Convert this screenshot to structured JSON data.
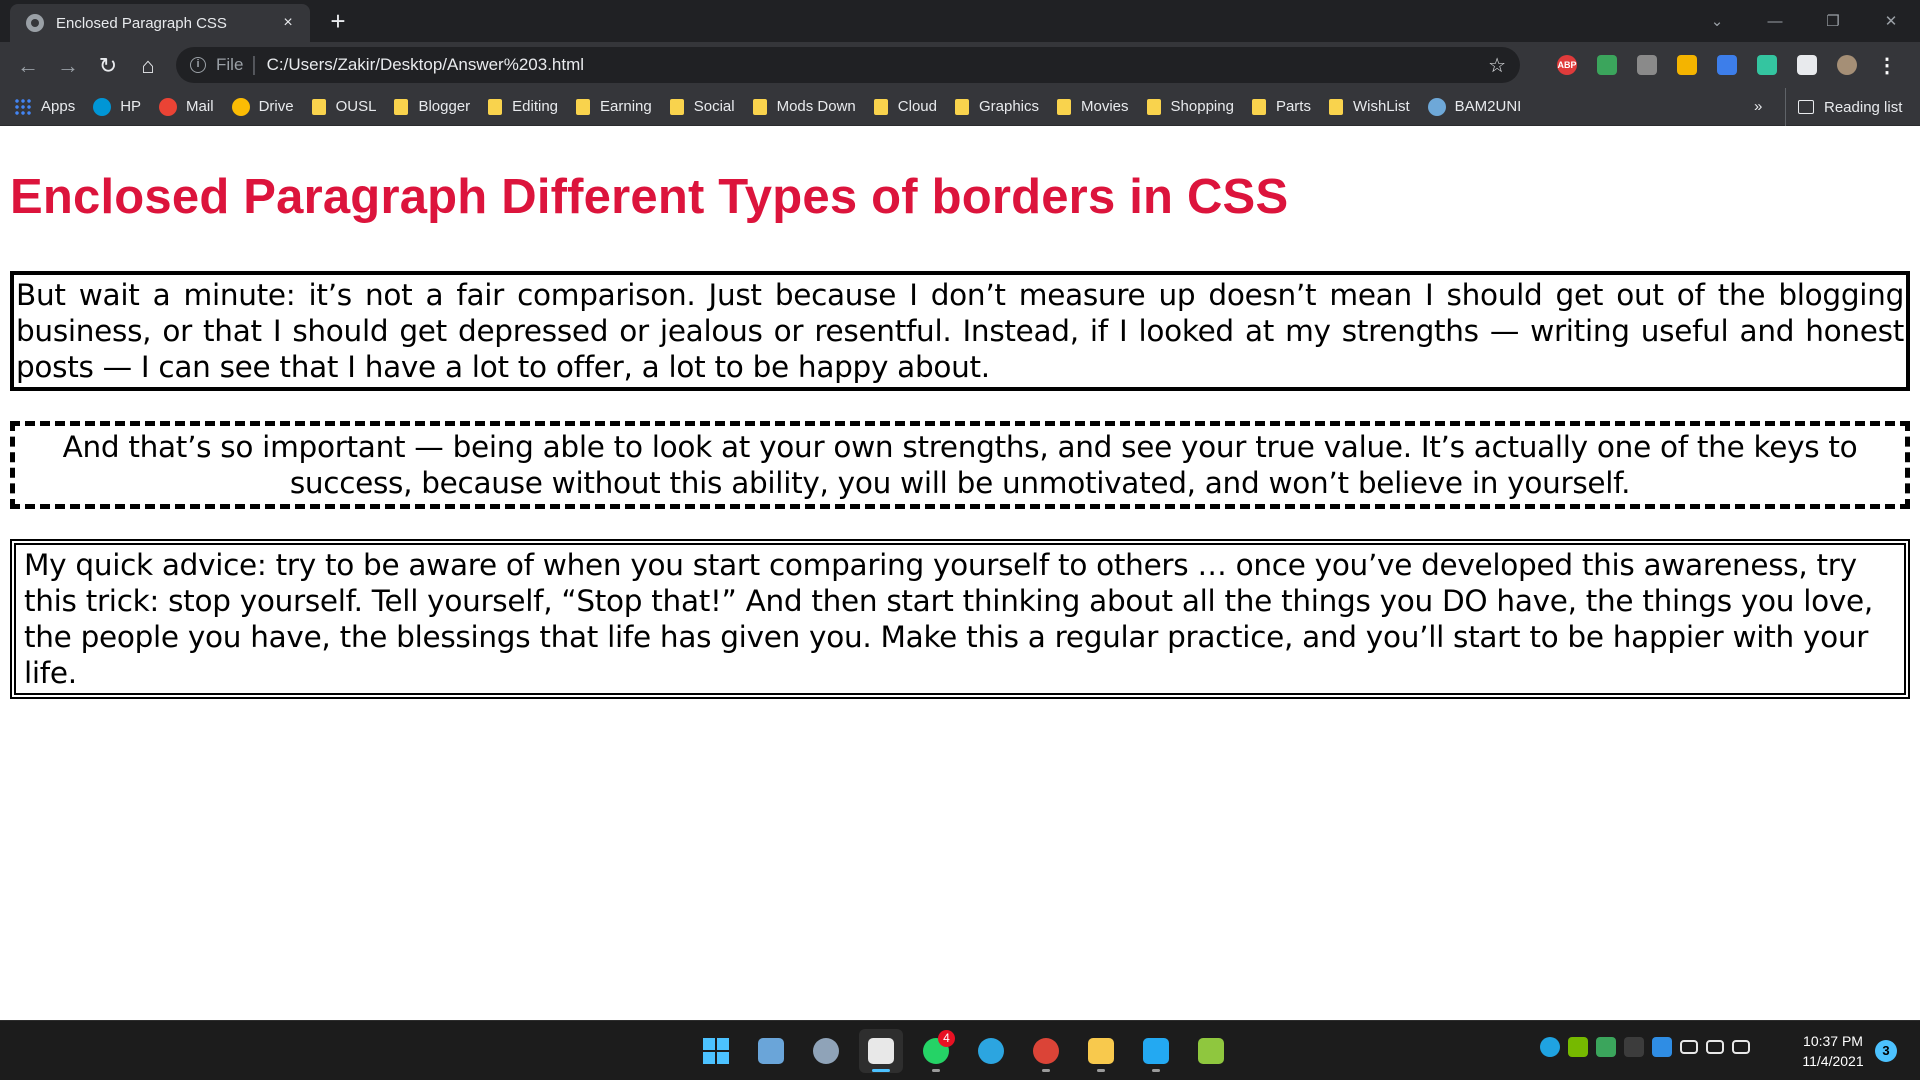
{
  "browser": {
    "tab_title": "Enclosed Paragraph CSS",
    "tab_close": "×",
    "new_tab": "+",
    "window_controls": {
      "dropdown": "⌄",
      "minimize": "—",
      "restore": "❐",
      "close": "✕"
    },
    "nav": {
      "back": "←",
      "forward": "→",
      "reload": "↻",
      "home": "⌂"
    },
    "address": {
      "info_glyph": "i",
      "scheme": "File",
      "separator": "|",
      "url": "C:/Users/Zakir/Desktop/Answer%203.html",
      "star": "☆"
    },
    "extensions": [
      {
        "name": "adblock-plus-icon",
        "label": "ABP",
        "color": "#e03b3b"
      },
      {
        "name": "extension-leaf-icon",
        "label": "",
        "color": "#3ba55c"
      },
      {
        "name": "pdf-extension-icon",
        "label": "",
        "color": "#8a8a8a"
      },
      {
        "name": "mail-checker-icon",
        "label": "",
        "color": "#f4b400"
      },
      {
        "name": "mascot-extension-icon",
        "label": "",
        "color": "#3d7eea"
      },
      {
        "name": "stripes-extension-icon",
        "label": "",
        "color": "#34c5a0"
      },
      {
        "name": "puzzle-extensions-icon",
        "label": "",
        "color": "#e8eaed"
      },
      {
        "name": "profile-avatar-icon",
        "label": "",
        "color": "#a58f76"
      },
      {
        "name": "kebab-menu-icon",
        "label": "⋮",
        "color": "#35363a"
      }
    ],
    "bookmarks": [
      {
        "label": "Apps",
        "kind": "apps",
        "color": "#4285f4"
      },
      {
        "label": "HP",
        "kind": "icon",
        "color": "#0096d6"
      },
      {
        "label": "Mail",
        "kind": "icon",
        "color": "#ea4335"
      },
      {
        "label": "Drive",
        "kind": "icon",
        "color": "#fbbc04"
      },
      {
        "label": "OUSL",
        "kind": "folder"
      },
      {
        "label": "Blogger",
        "kind": "folder"
      },
      {
        "label": "Editing",
        "kind": "folder"
      },
      {
        "label": "Earning",
        "kind": "folder"
      },
      {
        "label": "Social",
        "kind": "folder"
      },
      {
        "label": "Mods Down",
        "kind": "folder"
      },
      {
        "label": "Cloud",
        "kind": "folder"
      },
      {
        "label": "Graphics",
        "kind": "folder"
      },
      {
        "label": "Movies",
        "kind": "folder"
      },
      {
        "label": "Shopping",
        "kind": "folder"
      },
      {
        "label": "Parts",
        "kind": "folder"
      },
      {
        "label": "WishList",
        "kind": "folder"
      },
      {
        "label": "BAM2UNI",
        "kind": "icon",
        "color": "#6ea8d8"
      }
    ],
    "bookmarks_overflow": "»",
    "reading_list": "Reading list"
  },
  "page": {
    "heading": "Enclosed Paragraph Different Types of borders in CSS",
    "paragraphs": [
      "But wait a minute: it’s not a fair comparison. Just because I don’t measure up doesn’t mean I should get out of the blogging business, or that I should get depressed or jealous or resentful. Instead, if I looked at my strengths — writing useful and honest posts — I can see that I have a lot to offer, a lot to be happy about.",
      "And that’s so important — being able to look at your own strengths, and see your true value. It’s actually one of the keys to success, because without this ability, you will be unmotivated, and won’t believe in yourself.",
      "My quick advice: try to be aware of when you start comparing yourself to others … once you’ve developed this awareness, try this trick: stop yourself. Tell yourself, “Stop that!” And then start thinking about all the things you DO have, the things you love, the people you have, the blessings that life has given you. Make this a regular practice, and you’ll start to be happier with your life."
    ],
    "heading_color": "#dc143c"
  },
  "taskbar": {
    "apps": [
      {
        "name": "start-button",
        "color": "#4cc2ff",
        "active": false,
        "indicator": false,
        "badge": ""
      },
      {
        "name": "photos-app-icon",
        "color": "#6aa5d9",
        "active": false,
        "indicator": false,
        "badge": ""
      },
      {
        "name": "settings-gear-icon",
        "color": "#8fa3b8",
        "active": false,
        "indicator": false,
        "badge": ""
      },
      {
        "name": "snipping-tool-icon",
        "color": "#e8e8e8",
        "active": true,
        "indicator": true,
        "badge": ""
      },
      {
        "name": "whatsapp-icon",
        "color": "#25d366",
        "active": false,
        "indicator": true,
        "badge": "4"
      },
      {
        "name": "telegram-icon",
        "color": "#2ca5e0",
        "active": false,
        "indicator": false,
        "badge": ""
      },
      {
        "name": "chrome-icon",
        "color": "#db4437",
        "active": false,
        "indicator": true,
        "badge": ""
      },
      {
        "name": "file-explorer-icon",
        "color": "#f8c94d",
        "active": false,
        "indicator": true,
        "badge": ""
      },
      {
        "name": "vscode-icon",
        "color": "#23a9f2",
        "active": false,
        "indicator": true,
        "badge": ""
      },
      {
        "name": "notepad-plus-icon",
        "color": "#8fc73e",
        "active": false,
        "indicator": false,
        "badge": ""
      }
    ],
    "tray": [
      {
        "name": "edge-tray-icon",
        "color": "#1fa3e1"
      },
      {
        "name": "nvidia-tray-icon",
        "color": "#76b900"
      },
      {
        "name": "extension-tray-icon",
        "color": "#3ba55c"
      },
      {
        "name": "bitdefender-tray-icon",
        "color": "#3c3c3c"
      },
      {
        "name": "defender-shield-icon",
        "color": "#2f8de4"
      },
      {
        "name": "wifi-icon",
        "color": "#e8e8e8"
      },
      {
        "name": "volume-icon",
        "color": "#e8e8e8"
      },
      {
        "name": "battery-icon",
        "color": "#e8e8e8"
      }
    ],
    "time": "10:37 PM",
    "date": "11/4/2021",
    "notifications": "3"
  }
}
